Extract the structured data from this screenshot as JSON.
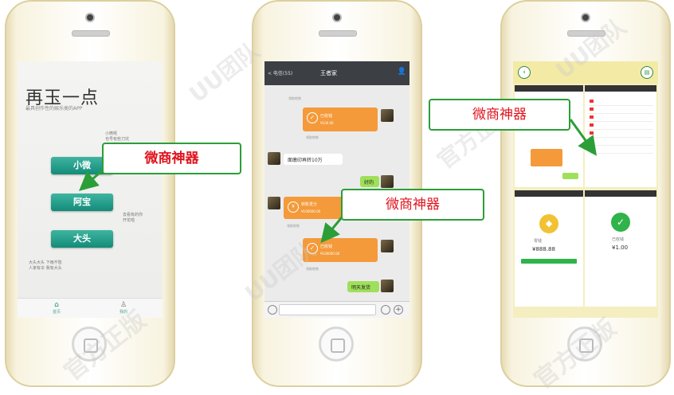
{
  "callouts": [
    "微商神器",
    "微商神器",
    "微商神器"
  ],
  "watermarks": [
    "UU团队",
    "官方正版",
    "UU团队",
    "官方正版",
    "官方正版",
    "UU团队"
  ],
  "phone1": {
    "logo": "再玉一点",
    "tagline": "最具创作性的娱乐类的APP",
    "note_top": "小微呢\n也号有些刀坑\n动了的",
    "buttons": [
      "小微",
      "阿宝",
      "大头"
    ],
    "note_mid": "去看有的你\n开花啦",
    "note_bottom": "大头大头 下雨不愁\n人家有伞 我有大头",
    "tabs": [
      "首页",
      "我的"
    ]
  },
  "phone2": {
    "back": "< 电信(55)",
    "title": "王者家",
    "messages": [
      {
        "side": "left",
        "kind": "tap",
        "text": "领取地铁"
      },
      {
        "side": "right",
        "kind": "transfer",
        "text": "已收钱",
        "sub": "¥100.00"
      },
      {
        "side": "right",
        "kind": "tap",
        "text": "领取地铁"
      },
      {
        "side": "left",
        "kind": "text",
        "text": "面缴印再转10万"
      },
      {
        "side": "right",
        "kind": "text",
        "text": "好的"
      },
      {
        "side": "left",
        "kind": "transfer",
        "text": "转账发分",
        "sub": "¥100000.00"
      },
      {
        "side": "left",
        "kind": "tap",
        "text": "领取地铁"
      },
      {
        "side": "right",
        "kind": "transfer",
        "text": "已收钱",
        "sub": "¥100000.00"
      },
      {
        "side": "right",
        "kind": "tap",
        "text": "领取地铁"
      },
      {
        "side": "right",
        "kind": "text",
        "text": "明天发货"
      }
    ]
  },
  "phone3": {
    "amount_left": "¥888.88",
    "amount_right": "¥1.00",
    "title_left": "零钱",
    "title_right": "已收钱"
  },
  "colors": {
    "callout_border": "#2b9e38",
    "callout_text": "#e0141e",
    "teal": "#1a9580",
    "orange": "#f49a3a",
    "wechat_green": "#9fe05a"
  }
}
